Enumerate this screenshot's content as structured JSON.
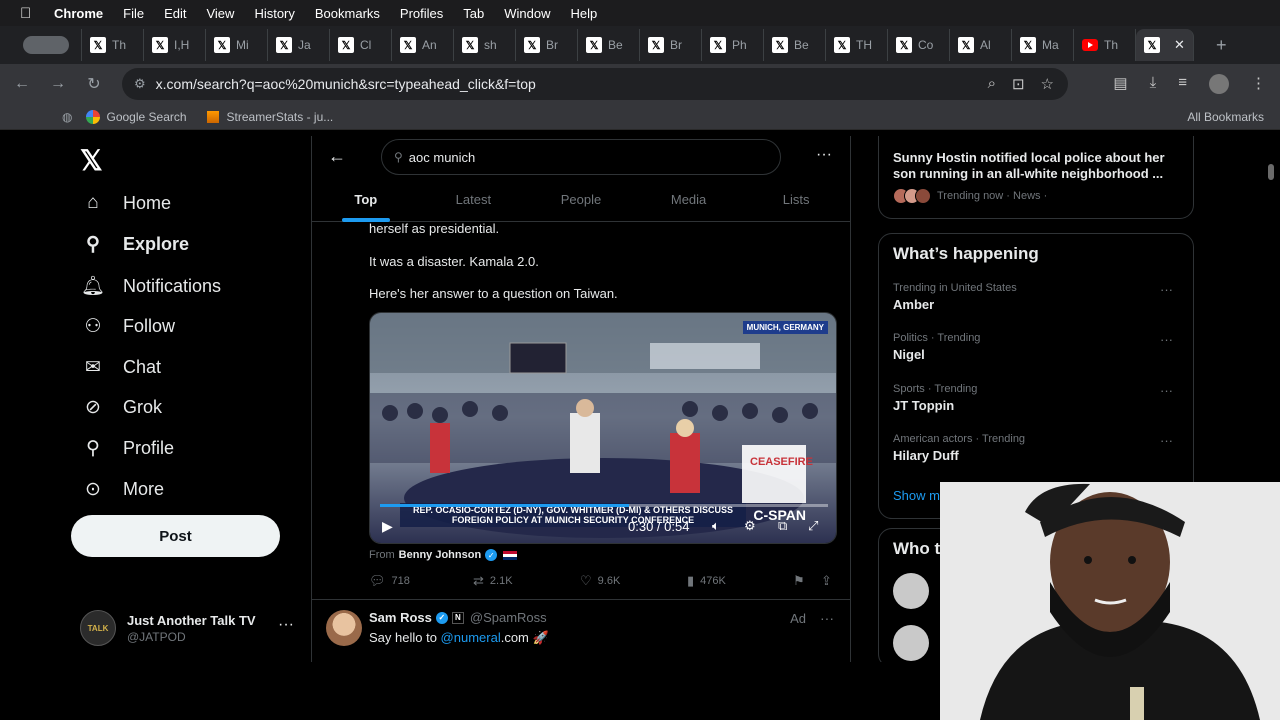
{
  "menubar": {
    "items": [
      "Chrome",
      "File",
      "Edit",
      "View",
      "History",
      "Bookmarks",
      "Profiles",
      "Tab",
      "Window",
      "Help"
    ]
  },
  "tabs": {
    "items": [
      "Th",
      "I,H",
      "Mi",
      "Ja",
      "Cl",
      "An",
      "sh",
      "Br",
      "Be",
      "Br",
      "Ph",
      "Be",
      "TH",
      "Co",
      "Al",
      "Ma",
      "Th"
    ],
    "youtube_index": 16
  },
  "address": {
    "url": "x.com/search?q=aoc%20munich&src=typeahead_click&f=top"
  },
  "bookmarks": {
    "items": [
      "Google Search",
      "StreamerStats - ju..."
    ],
    "all_label": "All Bookmarks"
  },
  "nav": {
    "items": [
      {
        "label": "Home",
        "icon": "home-icon"
      },
      {
        "label": "Explore",
        "icon": "search-icon"
      },
      {
        "label": "Notifications",
        "icon": "bell-icon"
      },
      {
        "label": "Follow",
        "icon": "follow-icon"
      },
      {
        "label": "Chat",
        "icon": "mail-icon"
      },
      {
        "label": "Grok",
        "icon": "grok-icon"
      },
      {
        "label": "Profile",
        "icon": "person-icon"
      },
      {
        "label": "More",
        "icon": "more-circle-icon"
      }
    ],
    "active": "Explore",
    "post_label": "Post",
    "account": {
      "name": "Just Another Talk TV",
      "handle": "@JATPOD",
      "avatar_text": "TALK"
    }
  },
  "search": {
    "query": "aoc munich",
    "tabs": [
      "Top",
      "Latest",
      "People",
      "Media",
      "Lists"
    ],
    "active_tab": "Top"
  },
  "tweet": {
    "lines": [
      "herself as presidential.",
      "It was a disaster. Kamala 2.0.",
      "Here's her answer to a question on Taiwan."
    ],
    "video": {
      "location_label": "MUNICH, GERMANY",
      "banner": "REP. OCASIO-CORTEZ (D-NY), GOV. WHITMER (D-MI) & OTHERS DISCUSS FOREIGN POLICY AT MUNICH SECURITY CONFERENCE",
      "network": "C-SPAN",
      "time": "0:30 / 0:54",
      "progress": 0.556
    },
    "from_prefix": "From",
    "from_name": "Benny Johnson",
    "stats": {
      "replies": "718",
      "reposts": "2.1K",
      "likes": "9.6K",
      "views": "476K"
    }
  },
  "ad": {
    "name": "Sam Ross",
    "handle": "@SpamRoss",
    "label": "Ad",
    "text_prefix": "Say hello to ",
    "mention": "@numeral",
    "text_suffix": ".com 🚀"
  },
  "right": {
    "top_trend": {
      "title": "Sunny Hostin notified local police about her son running in an all-white neighborhood ...",
      "meta": "Trending now · News ·"
    },
    "happening_title": "What’s happening",
    "trends": [
      {
        "context": "Trending in United States",
        "name": "Amber"
      },
      {
        "context": "Politics · Trending",
        "name": "Nigel"
      },
      {
        "context": "Sports · Trending",
        "name": "JT Toppin"
      },
      {
        "context": "American actors · Trending",
        "name": "Hilary Duff"
      }
    ],
    "show_more": "Show m",
    "who_title": "Who t"
  },
  "colors": {
    "accent": "#1d9bf0",
    "background": "#000000",
    "text": "#e7e9ea",
    "muted": "#71767b"
  }
}
